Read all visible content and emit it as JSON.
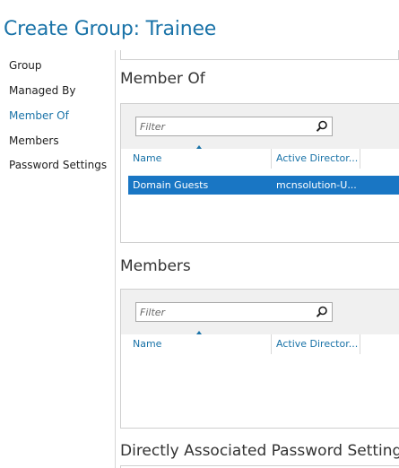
{
  "window": {
    "title": "Create Group: Trainee"
  },
  "nav": {
    "items": [
      {
        "label": "Group",
        "active": false
      },
      {
        "label": "Managed By",
        "active": false
      },
      {
        "label": "Member Of",
        "active": true
      },
      {
        "label": "Members",
        "active": false
      },
      {
        "label": "Password Settings",
        "active": false
      }
    ]
  },
  "member_of": {
    "title": "Member Of",
    "filter_placeholder": "Filter",
    "columns": [
      "Name",
      "Active Director..."
    ],
    "rows": [
      {
        "name": "Domain Guests",
        "source": "mcnsolution-U...",
        "selected": true
      }
    ]
  },
  "members": {
    "title": "Members",
    "filter_placeholder": "Filter",
    "columns": [
      "Name",
      "Active Director..."
    ],
    "rows": []
  },
  "password_settings": {
    "title": "Directly Associated Password Settings"
  },
  "colors": {
    "accent": "#1a73a8",
    "selection": "#1976c4",
    "toolbar": "#f0f0f0"
  },
  "icons": {
    "search": "search-icon",
    "sort": "sort-ascending-icon"
  }
}
